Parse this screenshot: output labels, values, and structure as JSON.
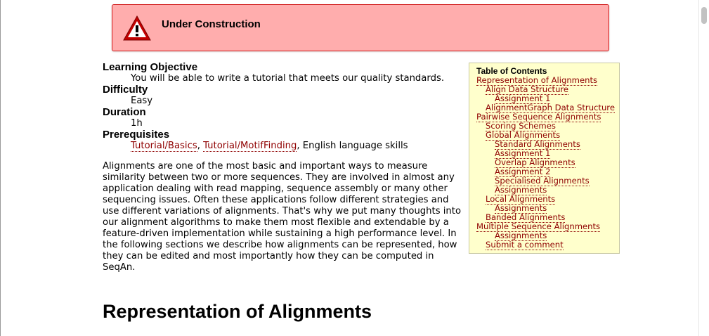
{
  "banner": {
    "icon": "warning-icon",
    "text": "Under Construction",
    "bg_color": "#ffadad",
    "border_color": "#d11c1c"
  },
  "fields": {
    "objective_label": "Learning Objective",
    "objective_value": "You will be able to write a tutorial that meets our quality standards.",
    "difficulty_label": "Difficulty",
    "difficulty_value": "Easy",
    "duration_label": "Duration",
    "duration_value": "1h",
    "prereq_label": "Prerequisites",
    "prereq_link1": "Tutorial/Basics",
    "prereq_sep": ", ",
    "prereq_link2": "Tutorial/MotifFinding",
    "prereq_rest": ", English language skills"
  },
  "intro": "Alignments are one of the most basic and important ways to measure similarity between two or more sequences. They are involved in almost any application dealing with read mapping, sequence assembly or many other sequencing issues. Often these applications follow different strategies and use different variations of alignments. That's why we put many thoughts into our alignment algorithms to make them most flexible and extendable by a feature-driven implementation while sustaining a high performance level. In the following sections we describe how alignments can be represented, how they can be edited and most importantly how they can be computed in SeqAn.",
  "heading": "Representation of Alignments",
  "toc": {
    "title": "Table of Contents",
    "items": [
      {
        "label": "Representation of Alignments",
        "level": 1
      },
      {
        "label": "Align Data Structure",
        "level": 2
      },
      {
        "label": "Assignment 1",
        "level": 3
      },
      {
        "label": "AlignmentGraph Data Structure",
        "level": 2
      },
      {
        "label": "Pairwise Sequence Alignments",
        "level": 1
      },
      {
        "label": "Scoring Schemes",
        "level": 2
      },
      {
        "label": "Global Alignments",
        "level": 2
      },
      {
        "label": "Standard Alignments",
        "level": 3
      },
      {
        "label": "Assignment 1",
        "level": 3
      },
      {
        "label": "Overlap Alignments",
        "level": 3
      },
      {
        "label": "Assignment 2",
        "level": 3
      },
      {
        "label": "Specialised Alignments",
        "level": 3
      },
      {
        "label": "Assignments",
        "level": 3
      },
      {
        "label": "Local Alignments",
        "level": 2
      },
      {
        "label": "Assignments",
        "level": 3
      },
      {
        "label": "Banded Alignments",
        "level": 2
      },
      {
        "label": "Multiple Sequence Alignments",
        "level": 1
      },
      {
        "label": "Assignments",
        "level": 3
      },
      {
        "label": "Submit a comment",
        "level": 2
      }
    ]
  },
  "colors": {
    "link": "#8f0000",
    "toc_bg": "#ffffcc"
  }
}
